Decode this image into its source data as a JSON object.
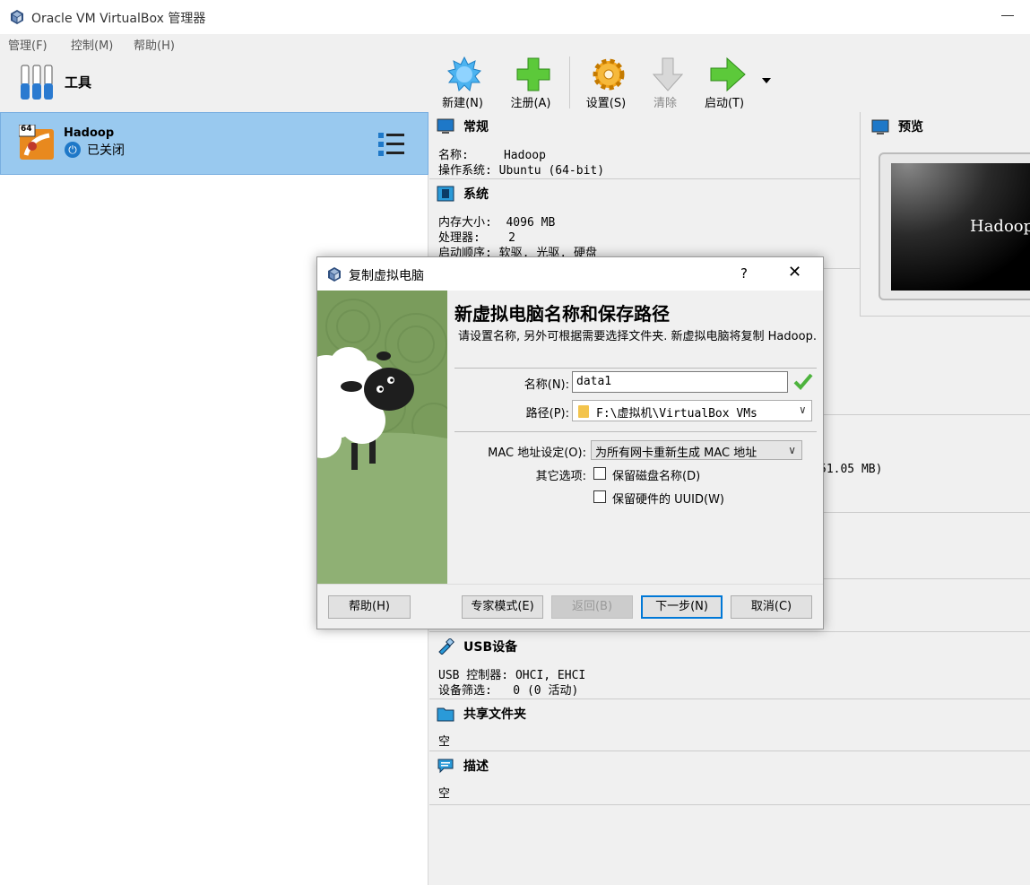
{
  "window": {
    "title": "Oracle VM VirtualBox 管理器"
  },
  "menu": [
    "管理(F)",
    "控制(M)",
    "帮助(H)"
  ],
  "tools": {
    "label": "工具"
  },
  "vm": {
    "name": "Hadoop",
    "state": "已关闭",
    "badge": "64"
  },
  "toolbar": {
    "new": "新建(N)",
    "register": "注册(A)",
    "settings": "设置(S)",
    "discard": "清除",
    "start": "启动(T)"
  },
  "details": {
    "general": {
      "title": "常规",
      "name_row": "名称:     Hadoop",
      "os_row": "操作系统: Ubuntu (64-bit)"
    },
    "system": {
      "title": "系统",
      "mem_row": "内存大小:  4096 MB",
      "cpu_row": "处理器:    2",
      "boot_row": "启动顺序: 软驱, 光驱, 硬盘"
    },
    "storage_fragment": "51.05 MB)",
    "usb": {
      "title": "USB设备",
      "ctrl_row": "USB 控制器: OHCI, EHCI",
      "filter_row": "设备筛选:   0 (0 活动)"
    },
    "shared": {
      "title": "共享文件夹",
      "value": "空"
    },
    "description": {
      "title": "描述",
      "value": "空"
    }
  },
  "preview": {
    "title": "预览",
    "screen_text": "Hadoop"
  },
  "dialog": {
    "title": "复制虚拟电脑",
    "help_mark": "?",
    "close_mark": "✕",
    "heading": "新虚拟电脑名称和保存路径",
    "description": "请设置名称, 另外可根据需要选择文件夹. 新虚拟电脑将复制 Hadoop.",
    "name_label": "名称(N):",
    "name_value": "data1",
    "path_label": "路径(P):",
    "path_value": "F:\\虚拟机\\VirtualBox VMs",
    "mac_label": "MAC 地址设定(O):",
    "mac_value": "为所有网卡重新生成 MAC 地址",
    "other_label": "其它选项:",
    "keep_disk_names": "保留磁盘名称(D)",
    "keep_uuids": "保留硬件的 UUID(W)",
    "buttons": {
      "help": "帮助(H)",
      "expert": "专家模式(E)",
      "back": "返回(B)",
      "next": "下一步(N)",
      "cancel": "取消(C)"
    }
  }
}
